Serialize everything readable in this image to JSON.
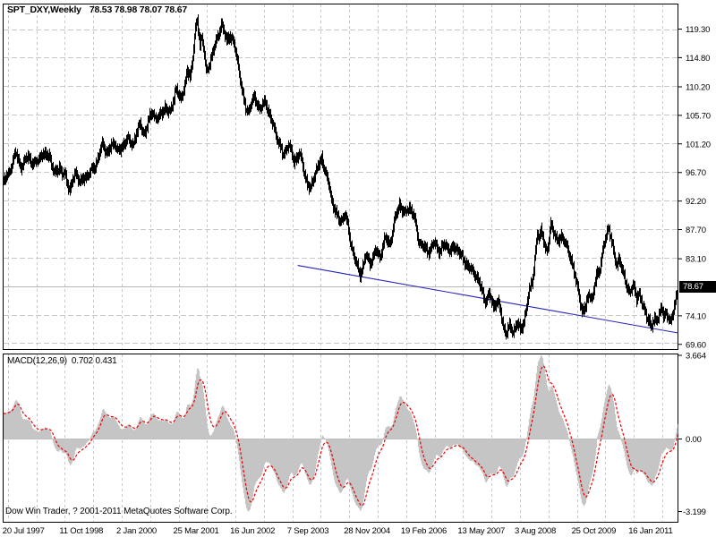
{
  "window": {
    "footer_credit": "Dow Win Trader, ? 2001-2011 MetaQuotes Software Corp."
  },
  "colors": {
    "background": "#ffffff",
    "panel_border": "#000000",
    "grid": "#c8c8c8",
    "bars": "#000000",
    "trendline_blue": "#2222b8",
    "macd_fill": "#c5c5c5",
    "signal_red": "#ee0000",
    "level_line_gray": "#b6b6b6",
    "badge_bg": "#000000",
    "badge_text": "#ffffff"
  },
  "chart_data": {
    "main": {
      "type": "ohlc_bar_series",
      "symbol_title": "SPT_DXY,Weekly",
      "quote": "78.53 78.98 78.07 78.67",
      "open": 78.53,
      "high": 78.98,
      "low": 78.07,
      "close": 78.67,
      "current_price": "78.67",
      "y_labels": [
        "119.30",
        "114.80",
        "110.20",
        "105.70",
        "101.20",
        "96.70",
        "92.20",
        "87.70",
        "83.10",
        "74.10",
        "69.60"
      ],
      "y_top_value": 119.3,
      "price_per_grid": 4.5,
      "weeks_per_grid": 32,
      "x_labels": [
        "20 Jul 1997",
        "11 Oct 1998",
        "2 Jan 2000",
        "25 Mar 2001",
        "16 Jun 2002",
        "7 Sep 2003",
        "28 Nov 2004",
        "19 Feb 2006",
        "13 May 2007",
        "3 Aug 2008",
        "25 Oct 2009",
        "16 Jan 2011"
      ],
      "trendline": {
        "from": {
          "week": 326,
          "price": 82.05
        },
        "to": {
          "week": 754,
          "price": 71.3
        }
      },
      "close_anchors": [
        [
          -44,
          88.5
        ],
        [
          -30,
          91.5
        ],
        [
          -16,
          93.8
        ],
        [
          -6,
          95.3
        ],
        [
          0,
          96.3
        ],
        [
          4,
          98.2
        ],
        [
          8,
          99.8
        ],
        [
          11,
          98.6
        ],
        [
          14,
          97.6
        ],
        [
          18,
          98.4
        ],
        [
          22,
          99.3
        ],
        [
          26,
          98.3
        ],
        [
          30,
          98.0
        ],
        [
          34,
          99.0
        ],
        [
          38,
          99.6
        ],
        [
          42,
          99.2
        ],
        [
          46,
          99.9
        ],
        [
          49,
          98.0
        ],
        [
          52,
          96.4
        ],
        [
          55,
          97.2
        ],
        [
          58,
          97.6
        ],
        [
          61,
          96.2
        ],
        [
          64,
          96.6
        ],
        [
          67,
          95.0
        ],
        [
          70,
          93.9
        ],
        [
          73,
          95.5
        ],
        [
          76,
          96.8
        ],
        [
          79,
          95.8
        ],
        [
          82,
          95.1
        ],
        [
          86,
          95.9
        ],
        [
          90,
          96.4
        ],
        [
          94,
          97.0
        ],
        [
          98,
          97.7
        ],
        [
          102,
          99.4
        ],
        [
          106,
          101.2
        ],
        [
          109,
          100.3
        ],
        [
          112,
          99.9
        ],
        [
          116,
          100.8
        ],
        [
          120,
          101.4
        ],
        [
          123,
          100.2
        ],
        [
          126,
          100.1
        ],
        [
          130,
          101.2
        ],
        [
          134,
          102.3
        ],
        [
          137,
          101.2
        ],
        [
          140,
          101.1
        ],
        [
          144,
          103.0
        ],
        [
          148,
          104.2
        ],
        [
          151,
          103.2
        ],
        [
          154,
          103.1
        ],
        [
          158,
          105.0
        ],
        [
          162,
          106.4
        ],
        [
          165,
          105.3
        ],
        [
          168,
          105.1
        ],
        [
          172,
          106.2
        ],
        [
          176,
          107.0
        ],
        [
          179,
          106.1
        ],
        [
          182,
          106.4
        ],
        [
          185,
          108.1
        ],
        [
          188,
          109.7
        ],
        [
          191,
          108.9
        ],
        [
          194,
          108.4
        ],
        [
          198,
          110.6
        ],
        [
          202,
          112.6
        ],
        [
          205,
          111.9
        ],
        [
          208,
          115.0
        ],
        [
          211,
          119.2
        ],
        [
          213,
          120.6
        ],
        [
          216,
          117.0
        ],
        [
          218,
          118.2
        ],
        [
          220,
          116.3
        ],
        [
          223,
          112.4
        ],
        [
          226,
          113.6
        ],
        [
          229,
          115.1
        ],
        [
          232,
          116.4
        ],
        [
          236,
          118.2
        ],
        [
          240,
          120.2
        ],
        [
          243,
          118.6
        ],
        [
          246,
          117.5
        ],
        [
          249,
          118.4
        ],
        [
          252,
          117.6
        ],
        [
          255,
          116.3
        ],
        [
          258,
          114.3
        ],
        [
          261,
          111.5
        ],
        [
          264,
          108.6
        ],
        [
          267,
          106.8
        ],
        [
          270,
          106.4
        ],
        [
          273,
          107.5
        ],
        [
          277,
          108.5
        ],
        [
          280,
          107.6
        ],
        [
          283,
          106.6
        ],
        [
          286,
          107.3
        ],
        [
          289,
          107.9
        ],
        [
          292,
          106.6
        ],
        [
          296,
          104.7
        ],
        [
          300,
          103.2
        ],
        [
          303,
          101.9
        ],
        [
          306,
          100.5
        ],
        [
          309,
          99.3
        ],
        [
          312,
          100.4
        ],
        [
          315,
          101.2
        ],
        [
          318,
          99.9
        ],
        [
          321,
          98.4
        ],
        [
          324,
          99.1
        ],
        [
          327,
          99.7
        ],
        [
          330,
          98.3
        ],
        [
          333,
          96.4
        ],
        [
          336,
          95.0
        ],
        [
          339,
          93.9
        ],
        [
          342,
          95.3
        ],
        [
          345,
          96.9
        ],
        [
          348,
          97.7
        ],
        [
          352,
          98.8
        ],
        [
          355,
          97.9
        ],
        [
          358,
          96.4
        ],
        [
          361,
          94.6
        ],
        [
          364,
          92.4
        ],
        [
          367,
          91.2
        ],
        [
          370,
          89.9
        ],
        [
          373,
          88.9
        ],
        [
          376,
          89.4
        ],
        [
          379,
          90.3
        ],
        [
          382,
          88.3
        ],
        [
          385,
          85.7
        ],
        [
          388,
          84.3
        ],
        [
          391,
          82.6
        ],
        [
          394,
          81.2
        ],
        [
          396,
          80.6
        ],
        [
          399,
          82.0
        ],
        [
          402,
          83.6
        ],
        [
          405,
          82.9
        ],
        [
          407,
          82.4
        ],
        [
          410,
          83.3
        ],
        [
          413,
          84.4
        ],
        [
          416,
          83.7
        ],
        [
          418,
          83.4
        ],
        [
          421,
          85.0
        ],
        [
          424,
          86.4
        ],
        [
          426,
          85.9
        ],
        [
          429,
          85.5
        ],
        [
          432,
          87.2
        ],
        [
          435,
          89.5
        ],
        [
          438,
          90.8
        ],
        [
          440,
          91.8
        ],
        [
          443,
          90.8
        ],
        [
          446,
          90.1
        ],
        [
          449,
          90.9
        ],
        [
          451,
          91.3
        ],
        [
          454,
          90.4
        ],
        [
          456,
          89.7
        ],
        [
          459,
          87.8
        ],
        [
          461,
          86.1
        ],
        [
          464,
          85.3
        ],
        [
          467,
          84.9
        ],
        [
          470,
          84.5
        ],
        [
          473,
          84.3
        ],
        [
          476,
          85.0
        ],
        [
          479,
          85.6
        ],
        [
          482,
          84.9
        ],
        [
          485,
          84.3
        ],
        [
          488,
          84.9
        ],
        [
          491,
          85.4
        ],
        [
          494,
          84.8
        ],
        [
          497,
          84.4
        ],
        [
          500,
          84.7
        ],
        [
          503,
          84.9
        ],
        [
          506,
          84.3
        ],
        [
          509,
          83.6
        ],
        [
          512,
          83.0
        ],
        [
          515,
          82.5
        ],
        [
          518,
          81.8
        ],
        [
          521,
          81.3
        ],
        [
          524,
          80.9
        ],
        [
          527,
          80.4
        ],
        [
          530,
          79.2
        ],
        [
          533,
          78.1
        ],
        [
          535,
          77.0
        ],
        [
          537,
          76.5
        ],
        [
          539,
          77.0
        ],
        [
          541,
          77.4
        ],
        [
          544,
          76.4
        ],
        [
          546,
          75.6
        ],
        [
          548,
          76.1
        ],
        [
          551,
          76.3
        ],
        [
          554,
          74.6
        ],
        [
          556,
          73.1
        ],
        [
          558,
          72.0
        ],
        [
          560,
          71.3
        ],
        [
          562,
          71.9
        ],
        [
          564,
          72.5
        ],
        [
          566,
          71.9
        ],
        [
          568,
          71.6
        ],
        [
          570,
          72.3
        ],
        [
          572,
          72.9
        ],
        [
          574,
          72.4
        ],
        [
          576,
          71.9
        ],
        [
          578,
          72.6
        ],
        [
          580,
          73.4
        ],
        [
          583,
          75.4
        ],
        [
          585,
          77.4
        ],
        [
          588,
          79.2
        ],
        [
          590,
          80.3
        ],
        [
          592,
          83.0
        ],
        [
          595,
          87.0
        ],
        [
          597,
          86.0
        ],
        [
          599,
          87.8
        ],
        [
          601,
          87.0
        ],
        [
          603,
          85.2
        ],
        [
          605,
          84.0
        ],
        [
          607,
          84.8
        ],
        [
          610,
          88.9
        ],
        [
          612,
          88.0
        ],
        [
          614,
          86.9
        ],
        [
          616,
          86.0
        ],
        [
          618,
          85.8
        ],
        [
          620,
          86.4
        ],
        [
          622,
          86.8
        ],
        [
          624,
          86.2
        ],
        [
          626,
          85.5
        ],
        [
          628,
          84.8
        ],
        [
          630,
          84.0
        ],
        [
          632,
          83.3
        ],
        [
          634,
          82.4
        ],
        [
          636,
          81.0
        ],
        [
          638,
          79.4
        ],
        [
          641,
          78.0
        ],
        [
          643,
          76.2
        ],
        [
          645,
          74.8
        ],
        [
          647,
          75.0
        ],
        [
          649,
          75.6
        ],
        [
          651,
          76.8
        ],
        [
          653,
          77.6
        ],
        [
          655,
          77.2
        ],
        [
          657,
          76.9
        ],
        [
          659,
          78.8
        ],
        [
          661,
          80.6
        ],
        [
          663,
          80.9
        ],
        [
          665,
          81.2
        ],
        [
          667,
          82.6
        ],
        [
          669,
          84.1
        ],
        [
          671,
          85.6
        ],
        [
          673,
          86.9
        ],
        [
          675,
          88.1
        ],
        [
          677,
          87.2
        ],
        [
          679,
          85.8
        ],
        [
          681,
          84.1
        ],
        [
          683,
          82.8
        ],
        [
          685,
          82.2
        ],
        [
          687,
          83.3
        ],
        [
          689,
          82.3
        ],
        [
          691,
          81.0
        ],
        [
          693,
          80.1
        ],
        [
          695,
          79.3
        ],
        [
          697,
          78.6
        ],
        [
          699,
          77.7
        ],
        [
          701,
          78.1
        ],
        [
          703,
          78.9
        ],
        [
          705,
          78.0
        ],
        [
          707,
          77.0
        ],
        [
          709,
          77.8
        ],
        [
          711,
          76.8
        ],
        [
          713,
          75.9
        ],
        [
          715,
          75.3
        ],
        [
          717,
          74.5
        ],
        [
          719,
          73.9
        ],
        [
          721,
          73.3
        ],
        [
          723,
          71.9
        ],
        [
          725,
          73.0
        ],
        [
          727,
          73.8
        ],
        [
          729,
          73.5
        ],
        [
          731,
          74.0
        ],
        [
          733,
          74.5
        ],
        [
          735,
          75.1
        ],
        [
          737,
          74.2
        ],
        [
          739,
          74.7
        ],
        [
          741,
          74.2
        ],
        [
          743,
          73.6
        ],
        [
          745,
          72.9
        ],
        [
          747,
          74.1
        ],
        [
          749,
          75.9
        ],
        [
          751,
          77.2
        ],
        [
          753,
          78.1
        ],
        [
          754,
          78.67
        ]
      ]
    },
    "macd": {
      "type": "histogram_area_with_signal_line",
      "label": "MACD(12,26,9)",
      "values_text": "0.702 0.431",
      "macd_value": 0.702,
      "signal_value": 0.431,
      "params": [
        12,
        26,
        9
      ],
      "y_labels": [
        "3.664",
        "0.00",
        "-3.199"
      ],
      "range": [
        -3.199,
        3.664
      ]
    }
  }
}
